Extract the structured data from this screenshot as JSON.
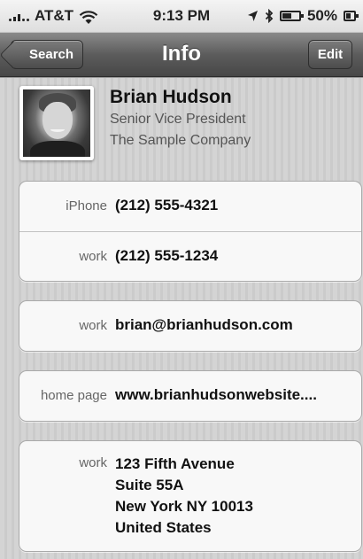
{
  "status_bar": {
    "carrier": "AT&T",
    "time": "9:13 PM",
    "battery": "50%"
  },
  "nav": {
    "back_label": "Search",
    "title": "Info",
    "edit_label": "Edit"
  },
  "contact": {
    "name": "Brian Hudson",
    "job_title": "Senior Vice President",
    "company": "The Sample Company"
  },
  "phones": [
    {
      "label": "iPhone",
      "value": "(212) 555-4321"
    },
    {
      "label": "work",
      "value": "(212) 555-1234"
    }
  ],
  "email": {
    "label": "work",
    "value": "brian@brianhudson.com"
  },
  "homepage": {
    "label": "home page",
    "value": "www.brianhudsonwebsite...."
  },
  "address": {
    "label": "work",
    "lines": [
      "123 Fifth Avenue",
      "Suite 55A",
      "New York NY 10013",
      "United States"
    ]
  },
  "icons": [
    "signal-icon",
    "wifi-icon",
    "location-arrow-icon",
    "bluetooth-icon",
    "battery-icon"
  ]
}
